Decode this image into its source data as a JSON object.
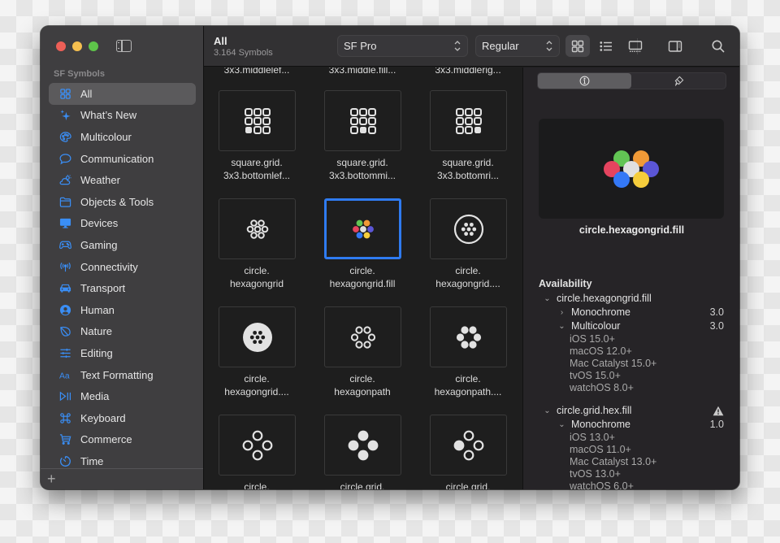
{
  "window": {
    "traffic_lights": [
      "close",
      "minimize",
      "zoom"
    ],
    "sidebar_toggle_icon": "sidebar-left-icon"
  },
  "sidebar": {
    "section_title": "SF Symbols",
    "items": [
      {
        "label": "All",
        "icon": "square-grid-2x2-icon",
        "active": true
      },
      {
        "label": "What’s New",
        "icon": "sparkles-icon"
      },
      {
        "label": "Multicolour",
        "icon": "paintpalette-icon"
      },
      {
        "label": "Communication",
        "icon": "message-bubble-icon"
      },
      {
        "label": "Weather",
        "icon": "cloud-sun-icon"
      },
      {
        "label": "Objects & Tools",
        "icon": "folder-icon"
      },
      {
        "label": "Devices",
        "icon": "desktopcomputer-icon"
      },
      {
        "label": "Gaming",
        "icon": "gamecontroller-icon"
      },
      {
        "label": "Connectivity",
        "icon": "antenna-radiowaves-icon"
      },
      {
        "label": "Transport",
        "icon": "car-icon"
      },
      {
        "label": "Human",
        "icon": "person-circle-icon"
      },
      {
        "label": "Nature",
        "icon": "leaf-icon"
      },
      {
        "label": "Editing",
        "icon": "slider-horizontal-icon"
      },
      {
        "label": "Text Formatting",
        "icon": "textformat-icon"
      },
      {
        "label": "Media",
        "icon": "playpause-icon"
      },
      {
        "label": "Keyboard",
        "icon": "command-icon"
      },
      {
        "label": "Commerce",
        "icon": "cart-icon"
      },
      {
        "label": "Time",
        "icon": "timer-icon"
      }
    ],
    "add_button": "+"
  },
  "toolbar": {
    "title": "All",
    "subtitle": "3.164 Symbols",
    "font_select": "SF Pro",
    "weight_select": "Regular",
    "buttons": [
      "grid-view-icon",
      "list-view-icon",
      "gallery-view-icon",
      "inspector-toggle-icon",
      "search-icon"
    ]
  },
  "grid": {
    "partial_top_labels": [
      "3x3.middlelef...",
      "3x3.middle.fill...",
      "3x3.middlerig..."
    ],
    "rows": [
      [
        {
          "label": "square.grid.\n3x3.bottomlef...",
          "glyph": "sq-bl"
        },
        {
          "label": "square.grid.\n3x3.bottommi...",
          "glyph": "sq-bm"
        },
        {
          "label": "square.grid.\n3x3.bottomri...",
          "glyph": "sq-br"
        }
      ],
      [
        {
          "label": "circle.\nhexagongrid",
          "glyph": "hexgrid"
        },
        {
          "label": "circle.\nhexagongrid.fill",
          "glyph": "hexgrid-fill",
          "selected": true
        },
        {
          "label": "circle.\nhexagongrid....",
          "glyph": "hexgrid-circle"
        }
      ],
      [
        {
          "label": "circle.\nhexagongrid....",
          "glyph": "hexgrid-circle-fill"
        },
        {
          "label": "circle.\nhexagonpath",
          "glyph": "hexpath"
        },
        {
          "label": "circle.\nhexagonpath....",
          "glyph": "hexpath-fill"
        }
      ],
      [
        {
          "label": "circle.",
          "glyph": "cross"
        },
        {
          "label": "circle.grid.",
          "glyph": "cross-fill"
        },
        {
          "label": "circle.grid.",
          "glyph": "cross-mixed"
        }
      ]
    ]
  },
  "inspector": {
    "tabs": [
      {
        "icon": "info-circle-icon",
        "active": true
      },
      {
        "icon": "paintbrush-icon",
        "active": false
      }
    ],
    "preview_name": "circle.hexagongrid.fill",
    "multicolor_palette": [
      "#62c554",
      "#f09a37",
      "#e5445f",
      "#e0e0e0",
      "#5b56d6",
      "#3478f6",
      "#f5cd3c"
    ],
    "availability_title": "Availability",
    "symbols": [
      {
        "name": "circle.hexagongrid.fill",
        "expanded": true,
        "warning": false,
        "modes": [
          {
            "name": "Monochrome",
            "version": "3.0",
            "expanded": false,
            "platforms": []
          },
          {
            "name": "Multicolour",
            "version": "3.0",
            "expanded": true,
            "platforms": [
              "iOS 15.0+",
              "macOS 12.0+",
              "Mac Catalyst 15.0+",
              "tvOS 15.0+",
              "watchOS 8.0+"
            ]
          }
        ]
      },
      {
        "name": "circle.grid.hex.fill",
        "expanded": true,
        "warning": true,
        "modes": [
          {
            "name": "Monochrome",
            "version": "1.0",
            "expanded": true,
            "platforms": [
              "iOS 13.0+",
              "macOS 11.0+",
              "Mac Catalyst 13.0+",
              "tvOS 13.0+",
              "watchOS 6.0+"
            ]
          }
        ]
      }
    ]
  }
}
